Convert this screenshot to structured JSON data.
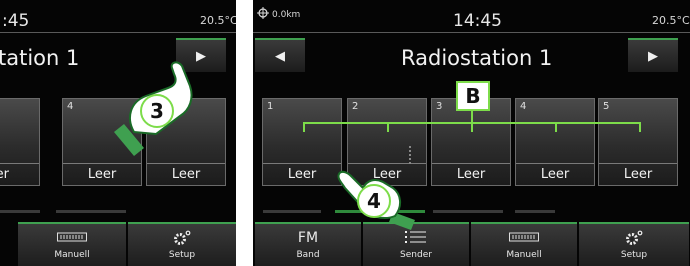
{
  "left_screen": {
    "time": ":45",
    "temperature": "20.5°C",
    "title": "tation 1",
    "next_button": "▶",
    "presets": [
      {
        "number": "",
        "label": "eer"
      },
      {
        "number": "4",
        "label": "Leer"
      },
      {
        "number": "",
        "label": "Leer"
      }
    ],
    "bottom_buttons": [
      {
        "icon": "manual-tuning-icon",
        "label": "Manuell"
      },
      {
        "icon": "gear-icon",
        "label": "Setup"
      }
    ],
    "step_badge": "3"
  },
  "right_screen": {
    "odometer": "0.0km",
    "time": "14:45",
    "temperature": "20.5°C",
    "title": "Radiostation 1",
    "prev_button": "◀",
    "next_button": "▶",
    "presets": [
      {
        "number": "1",
        "label": "Leer"
      },
      {
        "number": "2",
        "label": "Leer"
      },
      {
        "number": "3",
        "label": "Leer"
      },
      {
        "number": "4",
        "label": "Leer"
      },
      {
        "number": "5",
        "label": "Leer"
      }
    ],
    "bottom_buttons": [
      {
        "top": "FM",
        "label": "Band"
      },
      {
        "icon": "list-icon",
        "label": "Sender"
      },
      {
        "icon": "manual-tuning-icon",
        "label": "Manuell"
      },
      {
        "icon": "gear-icon",
        "label": "Setup"
      }
    ],
    "callout_label": "B",
    "step_badge": "4"
  },
  "colors": {
    "accent_green": "#7ddc4a",
    "bar_green": "#2f8a3c",
    "screen_bg": "#050505"
  }
}
